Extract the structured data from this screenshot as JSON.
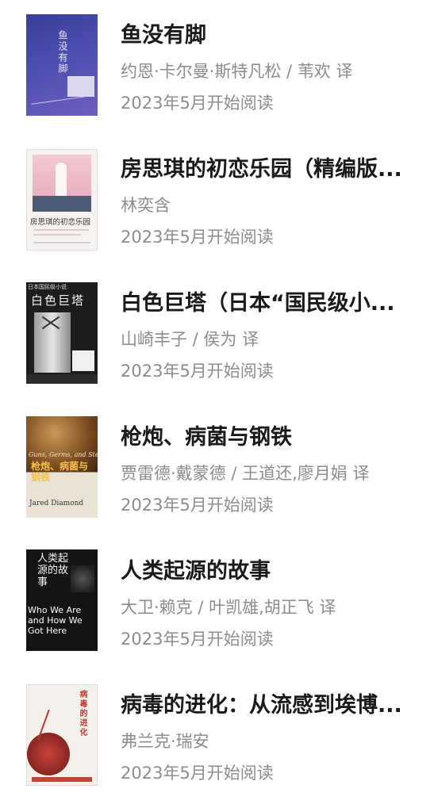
{
  "books": [
    {
      "title": "鱼没有脚",
      "author": "约恩·卡尔曼·斯特凡松 / 苇欢 译",
      "date": "2023年5月开始阅读",
      "cover_text": "鱼没有脚"
    },
    {
      "title": "房思琪的初恋乐园（精编版...",
      "author": "林奕含",
      "date": "2023年5月开始阅读",
      "cover_text": "房思琪的初恋乐园"
    },
    {
      "title": "白色巨塔（日本“国民级小...",
      "author": "山崎丰子 / 侯为 译",
      "date": "2023年5月开始阅读",
      "cover_text": "白色巨塔",
      "cover_top_text": "日本国民级小说"
    },
    {
      "title": "枪炮、病菌与钢铁",
      "author": "贾雷德·戴蒙德 / 王道还,廖月娟 译",
      "date": "2023年5月开始阅读",
      "cover_text_en": "Guns, Germs, and Steel",
      "cover_text_zh": "枪炮、病菌与钢铁",
      "cover_author": "Jared Diamond"
    },
    {
      "title": "人类起源的故事",
      "author": "大卫·赖克 / 叶凯雄,胡正飞 译",
      "date": "2023年5月开始阅读",
      "cover_text_zh": "人类起源的故事",
      "cover_text_en": "Who We Are and How We Got Here"
    },
    {
      "title": "病毒的进化：从流感到埃博...",
      "author": "弗兰克·瑞安",
      "date": "2023年5月开始阅读",
      "cover_text": "病毒的进化"
    }
  ],
  "colors": {
    "title": "#1a1a1a",
    "meta": "#8c8c8c",
    "background": "#ffffff"
  }
}
